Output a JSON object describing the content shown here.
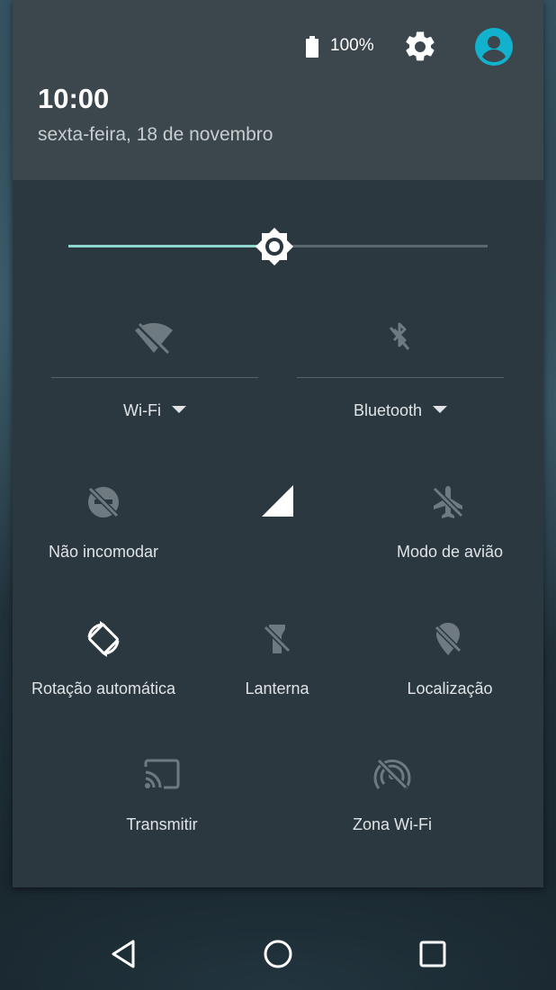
{
  "status": {
    "battery_label": "100%"
  },
  "header": {
    "time": "10:00",
    "date": "sexta-feira, 18 de novembro"
  },
  "brightness": {
    "level": 0.49
  },
  "tiles": {
    "wifi": {
      "label": "Wi-Fi",
      "icon": "wifi-off-icon"
    },
    "bluetooth": {
      "label": "Bluetooth",
      "icon": "bluetooth-off-icon"
    },
    "dnd": {
      "label": "Não incomodar",
      "icon": "do-not-disturb-off-icon"
    },
    "signal": {
      "label": "",
      "icon": "cell-signal-icon"
    },
    "airplane": {
      "label": "Modo de avião",
      "icon": "airplane-off-icon"
    },
    "rotation": {
      "label": "Rotação automática",
      "icon": "auto-rotate-icon"
    },
    "flashlight": {
      "label": "Lanterna",
      "icon": "flashlight-off-icon"
    },
    "location": {
      "label": "Localização",
      "icon": "location-off-icon"
    },
    "cast": {
      "label": "Transmitir",
      "icon": "cast-icon"
    },
    "hotspot": {
      "label": "Zona Wi-Fi",
      "icon": "hotspot-off-icon"
    }
  },
  "colors": {
    "accent": "#8fd6cf",
    "avatar": "#12b2ce",
    "panel": "#2b3840",
    "header": "#3b464d"
  }
}
